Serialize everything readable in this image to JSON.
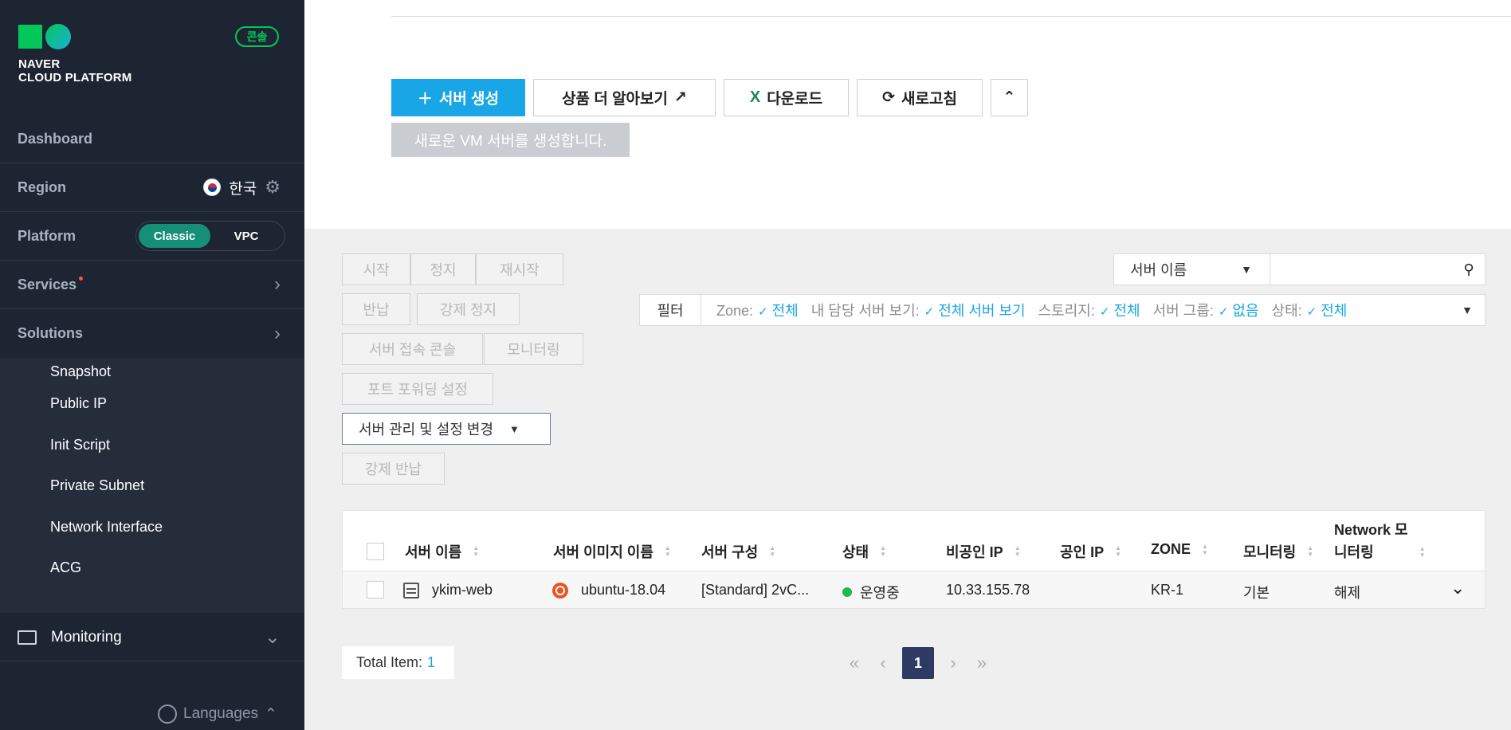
{
  "sidebar": {
    "logo_line1": "NAVER",
    "logo_line2": "CLOUD PLATFORM",
    "console_badge": "콘솔",
    "dashboard": "Dashboard",
    "region_label": "Region",
    "region_value": "한국",
    "platform_label": "Platform",
    "platform_options": [
      "Classic",
      "VPC"
    ],
    "platform_selected": "Classic",
    "services": "Services",
    "solutions": "Solutions",
    "sub_items": [
      "Snapshot",
      "Public IP",
      "Init Script",
      "Private Subnet",
      "Network Interface",
      "ACG"
    ],
    "monitoring": "Monitoring",
    "languages": "Languages"
  },
  "toolbar": {
    "create_label": "서버 생성",
    "learn_more_label": "상품 더 알아보기",
    "download_label": "다운로드",
    "refresh_label": "새로고침",
    "tooltip": "새로운 VM 서버를 생성합니다."
  },
  "actions": {
    "start": "시작",
    "stop": "정지",
    "restart": "재시작",
    "return": "반납",
    "force_stop": "강제 정지",
    "console_access": "서버 접속 콘솔",
    "monitoring": "모니터링",
    "port_forwarding": "포트 포워딩 설정",
    "manage_settings": "서버 관리 및 설정 변경",
    "force_return": "강제 반납"
  },
  "search": {
    "select_value": "서버 이름",
    "placeholder": ""
  },
  "filter": {
    "label": "필터",
    "items": [
      {
        "key": "Zone:",
        "value": "전체"
      },
      {
        "key": "내 담당 서버 보기:",
        "value": "전체 서버 보기"
      },
      {
        "key": "스토리지:",
        "value": "전체"
      },
      {
        "key": "서버 그룹:",
        "value": "없음"
      },
      {
        "key": "상태:",
        "value": "전체"
      }
    ]
  },
  "table": {
    "headers": [
      "서버 이름",
      "서버 이미지 이름",
      "서버 구성",
      "상태",
      "비공인 IP",
      "공인 IP",
      "ZONE",
      "모니터링",
      "Network 모니터링"
    ],
    "network_header_line1": "Network 모",
    "network_header_line2": "니터링",
    "rows": [
      {
        "name": "ykim-web",
        "image": "ubuntu-18.04",
        "spec": "[Standard] 2vC...",
        "status": "운영중",
        "private_ip": "10.33.155.78",
        "public_ip": "",
        "zone": "KR-1",
        "monitoring": "기본",
        "network_monitoring": "해제"
      }
    ]
  },
  "footer": {
    "total_label": "Total Item:",
    "total_count": "1",
    "current_page": "1"
  },
  "colors": {
    "primary": "#19a6e6",
    "sidebar_bg": "#1e2532",
    "brand_green": "#03c75a",
    "status_running": "#1db954",
    "page_active": "#2d3a63"
  }
}
